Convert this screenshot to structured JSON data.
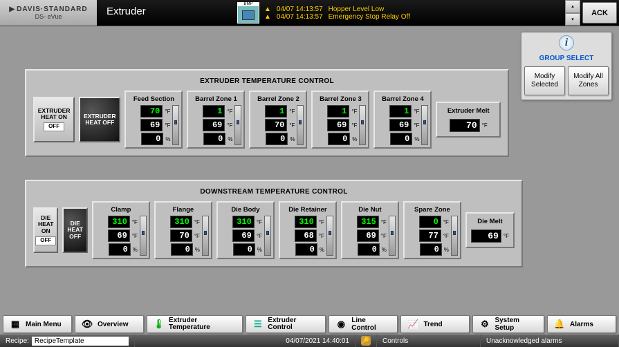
{
  "header": {
    "brand_top": "DAVIS·STANDARD",
    "brand_sub": "DS- eVue",
    "page_title": "Extruder",
    "ack_label": "ACK",
    "alarms": [
      {
        "time": "04/07 14:13:57",
        "msg": "Hopper Level Low"
      },
      {
        "time": "04/07 14:13:57",
        "msg": "Emergency Stop Relay Off"
      }
    ]
  },
  "group_select": {
    "title": "GROUP SELECT",
    "modify_selected": "Modify Selected",
    "modify_all": "Modify All Zones"
  },
  "extruder_panel": {
    "title": "EXTRUDER TEMPERATURE CONTROL",
    "heat_on_label": "EXTRUDER HEAT ON",
    "heat_on_state": "OFF",
    "heat_off_label": "EXTRUDER HEAT OFF",
    "melt_title": "Extruder Melt",
    "melt_value": "70",
    "melt_unit": "°F",
    "zones": [
      {
        "name": "Feed Section",
        "sp": "70",
        "pv": "69",
        "out": "0"
      },
      {
        "name": "Barrel Zone 1",
        "sp": "1",
        "pv": "69",
        "out": "0"
      },
      {
        "name": "Barrel Zone 2",
        "sp": "1",
        "pv": "70",
        "out": "0"
      },
      {
        "name": "Barrel Zone 3",
        "sp": "1",
        "pv": "69",
        "out": "0"
      },
      {
        "name": "Barrel Zone 4",
        "sp": "1",
        "pv": "69",
        "out": "0"
      }
    ]
  },
  "downstream_panel": {
    "title": "DOWNSTREAM TEMPERATURE CONTROL",
    "heat_on_label": "DIE HEAT ON",
    "heat_on_state": "OFF",
    "heat_off_label": "DIE HEAT OFF",
    "melt_title": "Die Melt",
    "melt_value": "69",
    "melt_unit": "°F",
    "zones": [
      {
        "name": "Clamp",
        "sp": "310",
        "pv": "69",
        "out": "0"
      },
      {
        "name": "Flange",
        "sp": "310",
        "pv": "70",
        "out": "0"
      },
      {
        "name": "Die Body",
        "sp": "310",
        "pv": "69",
        "out": "0"
      },
      {
        "name": "Die Retainer",
        "sp": "310",
        "pv": "68",
        "out": "0"
      },
      {
        "name": "Die Nut",
        "sp": "315",
        "pv": "69",
        "out": "0"
      },
      {
        "name": "Spare Zone",
        "sp": "0",
        "pv": "77",
        "out": "0"
      }
    ]
  },
  "units": {
    "temp": "°F",
    "pct": "%"
  },
  "nav": {
    "main_menu": "Main Menu",
    "overview": "Overview",
    "extruder_temp": "Extruder Temperature",
    "extruder_control": "Extruder Control",
    "line_control": "Line Control",
    "trend": "Trend",
    "system_setup": "System Setup",
    "alarms": "Alarms"
  },
  "status": {
    "recipe_label": "Recipe:",
    "recipe_value": "RecipeTemplate",
    "datetime": "04/07/2021 14:40:01",
    "controls_label": "Controls",
    "unack_label": "Unacknowledged alarms"
  }
}
